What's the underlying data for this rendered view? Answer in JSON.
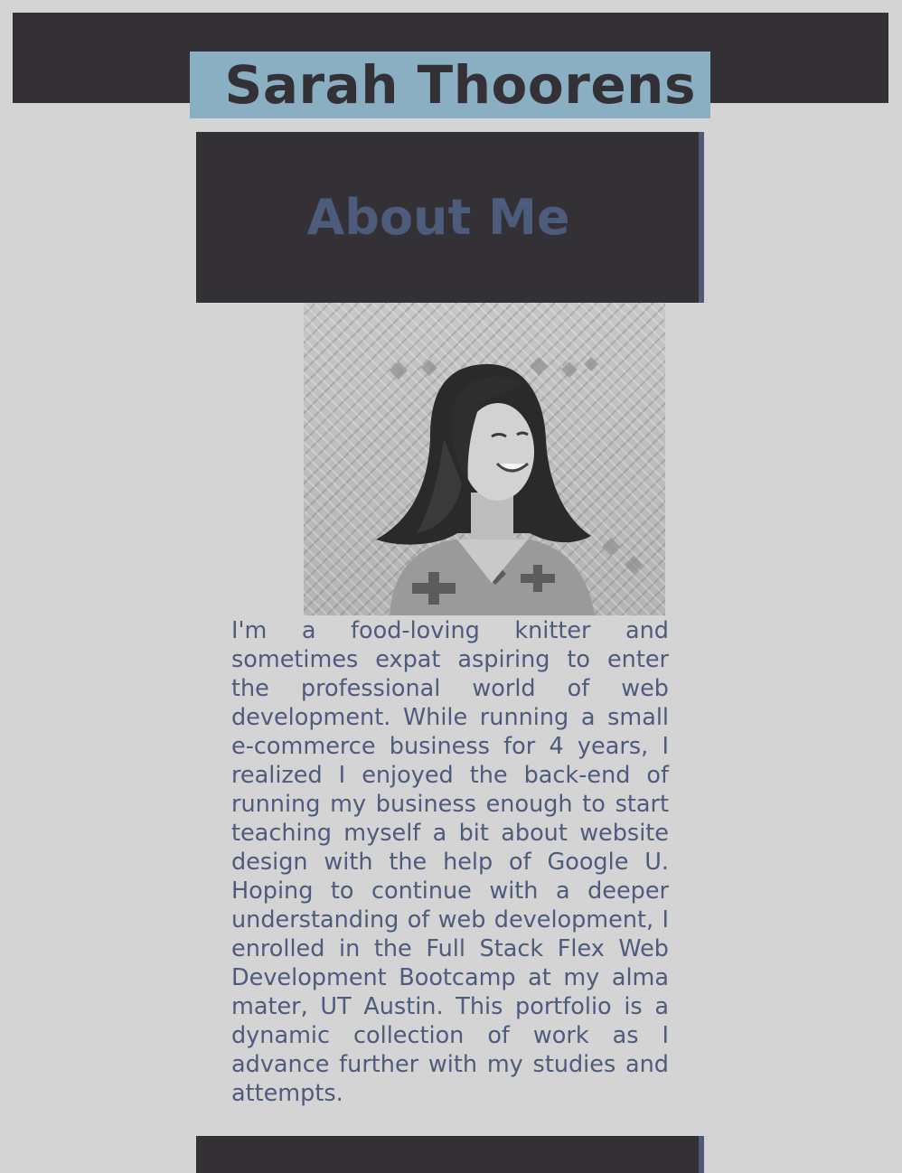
{
  "header": {
    "name": "Sarah Thoorens"
  },
  "about": {
    "heading": "About Me",
    "photo_alt": "Sarah Thoorens",
    "bio": "I'm a food-loving knitter and sometimes expat aspiring to enter the professional world of web development. While running a small e-commerce business for 4 years, I realized I enjoyed the back-end of running my business enough to start teaching myself a bit about website design with the help of Google U. Hoping to continue with a deeper understanding of web development, I enrolled in the Full Stack Flex Web Development Bootcamp at my alma mater, UT Austin. This portfolio is a dynamic collection of work as I advance further with my studies and attempts."
  },
  "colors": {
    "background": "#d4d4d4",
    "dark": "#333136",
    "name_box": "#8aafc2",
    "accent_text": "#4d5b7c"
  }
}
